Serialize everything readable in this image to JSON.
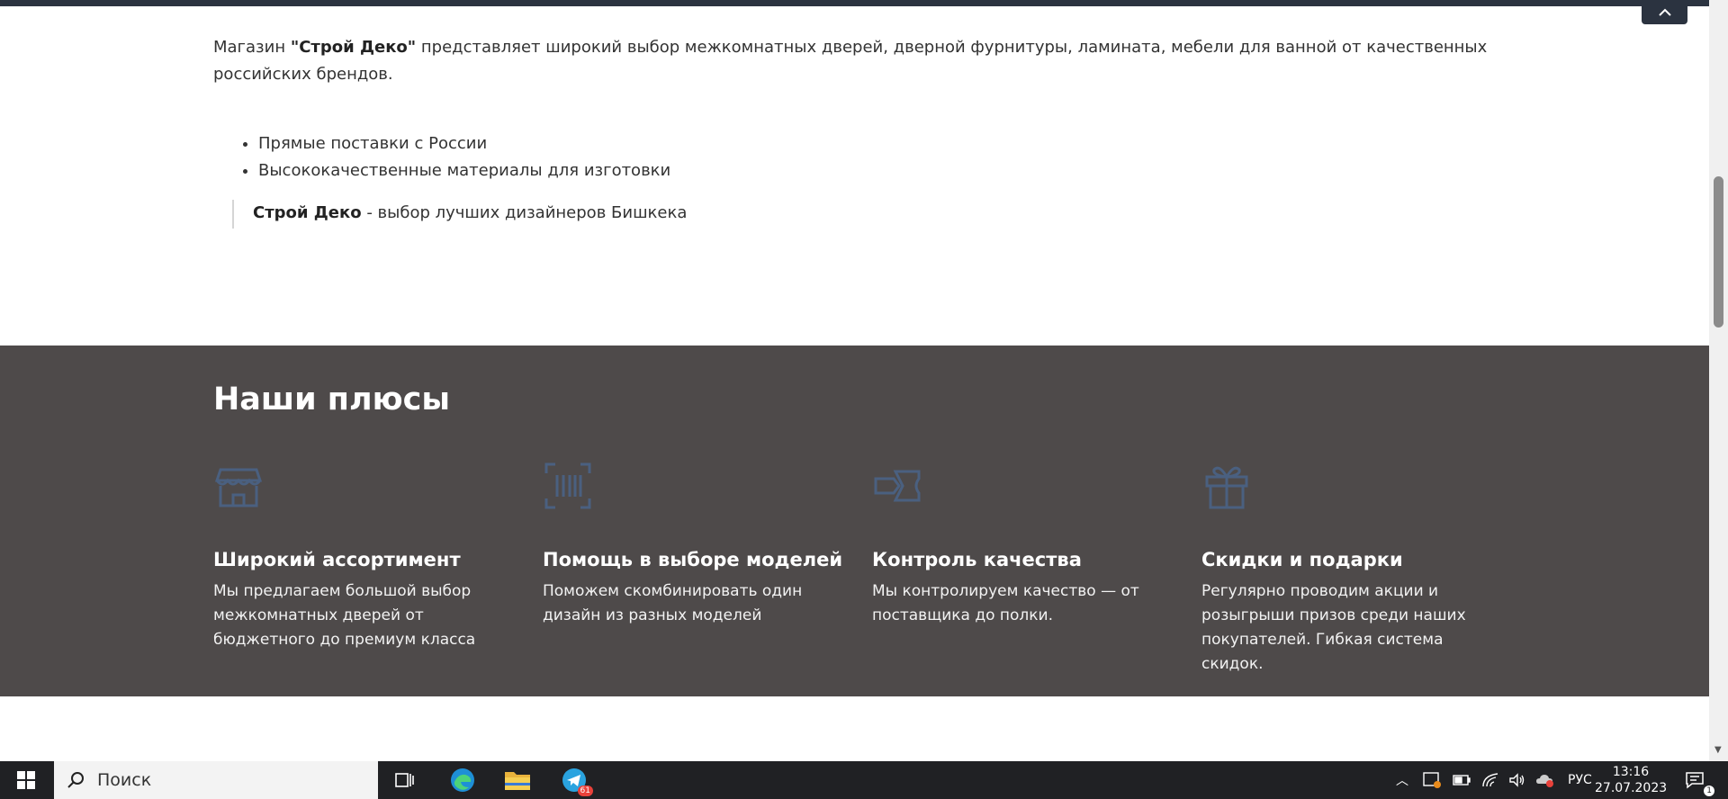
{
  "intro": {
    "prefix": "Магазин ",
    "brand": "\"Строй Деко\"",
    "rest": " представляет широкий выбор межкомнатных дверей, дверной фурнитуры, ламината, мебели для ванной от качественных российских брендов."
  },
  "bullets": [
    "Прямые поставки с России",
    "Высококачественные материалы для изготовки"
  ],
  "quote": {
    "brand": "Строй Деко",
    "rest": " - выбор лучших дизайнеров Бишкека"
  },
  "plus": {
    "title": "Наши плюсы",
    "features": [
      {
        "icon": "store-icon",
        "title": "Широкий ассортимент",
        "text": "Мы предлагаем большой выбор межкомнатных дверей от бюджетного до премиум класса"
      },
      {
        "icon": "barcode-scan-icon",
        "title": "Помощь в выборе моделей",
        "text": "Поможем скомбинировать один дизайн из разных моделей"
      },
      {
        "icon": "ticket-icon",
        "title": "Контроль качества",
        "text": "Мы контролируем качество — от поставщика до полки."
      },
      {
        "icon": "gift-icon",
        "title": "Скидки и подарки",
        "text": "Регулярно проводим акции и розыгрыши призов среди наших покупателей. Гибкая система скидок."
      }
    ],
    "icon_color": "#4a6080"
  },
  "taskbar": {
    "search_placeholder": "Поиск",
    "telegram_badge": "61",
    "lang": "РУС",
    "time": "13:16",
    "date": "27.07.2023",
    "notif_count": "1"
  },
  "colors": {
    "accent": "#2b3340",
    "section_bg": "#4e4a4a",
    "taskbar_bg": "#202124"
  }
}
